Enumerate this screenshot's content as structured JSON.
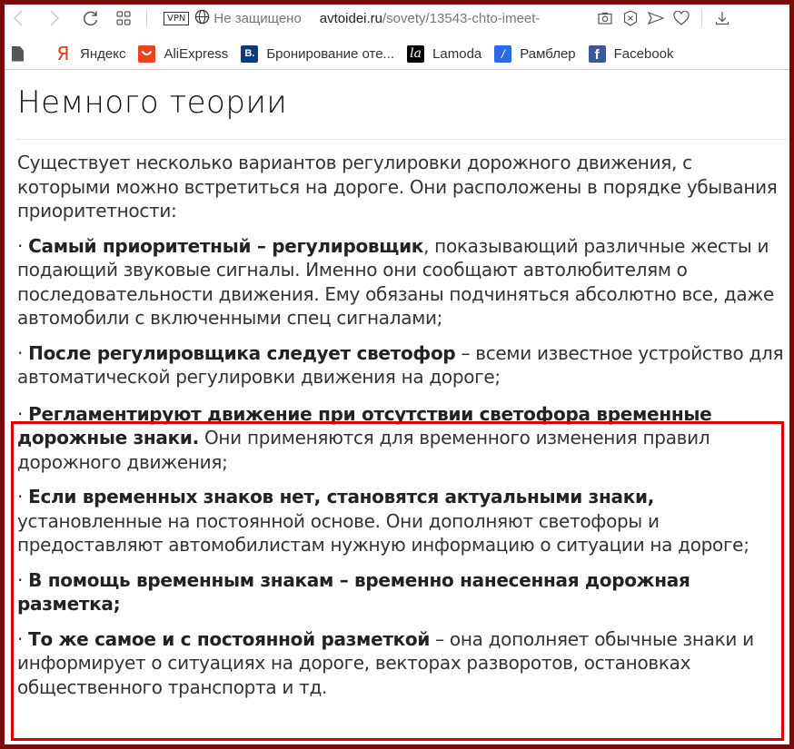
{
  "browser": {
    "toolbar": {
      "back_icon": "chevron-left-icon",
      "forward_icon": "chevron-right-icon",
      "reload_icon": "reload-icon",
      "tabs_icon": "grid-icon",
      "vpn_label": "VPN",
      "security_label": "Не защищено",
      "url_host": "avtoidei.ru",
      "url_path": "/sovety/13543-chto-imeet-",
      "right_icons": [
        "camera-icon",
        "shield-x-icon",
        "send-icon",
        "heart-icon",
        "download-icon"
      ]
    },
    "bookmarks": [
      {
        "label": "Яндекс",
        "icon": "yandex-icon",
        "glyph": "Я",
        "color": "#e0321d"
      },
      {
        "label": "AliExpress",
        "icon": "aliexpress-icon",
        "glyph": "◡",
        "color": "#e8461f"
      },
      {
        "label": "Бронирование оте...",
        "icon": "booking-icon",
        "glyph": "B.",
        "color": "#0c3b7c"
      },
      {
        "label": "Lamoda",
        "icon": "lamoda-icon",
        "glyph": "la",
        "color": "#000000"
      },
      {
        "label": "Рамблер",
        "icon": "rambler-icon",
        "glyph": "/",
        "color": "#2b6ae0"
      },
      {
        "label": "Facebook",
        "icon": "facebook-icon",
        "glyph": "f",
        "color": "#3b5998"
      }
    ]
  },
  "article": {
    "heading": "Немного теории",
    "intro": "Существует несколько вариантов регулировки дорожного движения, с которыми можно встретиться на дороге. Они расположены в порядке убывания приоритетности:",
    "items": [
      {
        "bullet": "· ",
        "bold": "Самый приоритетный – регулировщик",
        "text": ", показывающий различные жесты и подающий звуковые сигналы. Именно они сообщают автолюбителям о последовательности движения. Ему обязаны подчиняться абсолютно все, даже автомобили с включенными спец сигналами;"
      },
      {
        "bullet": "· ",
        "bold": "После регулировщика следует светофор",
        "text": " – всеми известное устройство для автоматической регулировки движения на дороге;"
      },
      {
        "bullet": "· ",
        "bold": "Регламентируют движение при отсутствии светофора временные дорожные знаки.",
        "text": " Они применяются для временного изменения правил дорожного движения;"
      },
      {
        "bullet": "· ",
        "bold": "Если временных знаков нет, становятся актуальными знаки,",
        "text": " установленные на постоянной основе. Они дополняют светофоры и предоставляют автомобилистам нужную информацию о ситуации на дороге;"
      },
      {
        "bullet": "· ",
        "bold": "В помощь временным знакам – временно нанесенная дорожная разметка;",
        "text": ""
      },
      {
        "bullet": "· ",
        "bold": "То же самое и с постоянной разметкой",
        "text": " – она дополняет обычные знаки и информирует о ситуациях на дороге, векторах разворотов, остановках общественного транспорта и тд."
      }
    ]
  },
  "annotation": {
    "highlight_color": "#e00000",
    "frame_color": "#7a0a0a"
  }
}
